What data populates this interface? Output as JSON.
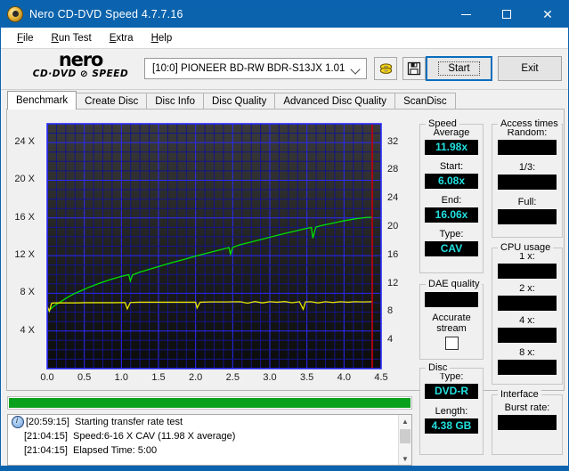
{
  "window": {
    "title": "Nero CD-DVD Speed 4.7.7.16",
    "icon": "nero-disc-icon",
    "minimize": "–",
    "maximize": "□",
    "close": "✕"
  },
  "menu": [
    {
      "pre": "",
      "acc": "F",
      "post": "ile"
    },
    {
      "pre": "",
      "acc": "R",
      "post": "un Test"
    },
    {
      "pre": "",
      "acc": "E",
      "post": "xtra"
    },
    {
      "pre": "",
      "acc": "H",
      "post": "elp"
    }
  ],
  "logo": {
    "line1": "nero",
    "line2": "CD·DVD ⊘ SPEED"
  },
  "toolbar": {
    "drive": "[10:0]   PIONEER BD-RW  BDR-S13JX 1.01",
    "eject_icon": "eject-disc-icon",
    "save_icon": "floppy-save-icon",
    "start_label": "Start",
    "exit_label": "Exit"
  },
  "tabs": [
    {
      "label": "Benchmark",
      "active": true
    },
    {
      "label": "Create Disc",
      "active": false
    },
    {
      "label": "Disc Info",
      "active": false
    },
    {
      "label": "Disc Quality",
      "active": false
    },
    {
      "label": "Advanced Disc Quality",
      "active": false
    },
    {
      "label": "ScanDisc",
      "active": false
    }
  ],
  "panels": {
    "speed": {
      "title": "Speed",
      "average_label": "Average",
      "average_value": "11.98x",
      "start_label": "Start:",
      "start_value": "6.08x",
      "end_label": "End:",
      "end_value": "16.06x",
      "type_label": "Type:",
      "type_value": "CAV"
    },
    "dae": {
      "title": "DAE quality",
      "value": "",
      "accurate_label": "Accurate",
      "stream_label": "stream",
      "checked": false
    },
    "disc": {
      "title": "Disc",
      "type_label": "Type:",
      "type_value": "DVD-R",
      "length_label": "Length:",
      "length_value": "4.38 GB"
    },
    "access": {
      "title": "Access times",
      "random_label": "Random:",
      "random_value": "",
      "third_label": "1/3:",
      "third_value": "",
      "full_label": "Full:",
      "full_value": ""
    },
    "cpu": {
      "title": "CPU usage",
      "rows": [
        {
          "label": "1 x:",
          "value": ""
        },
        {
          "label": "2 x:",
          "value": ""
        },
        {
          "label": "4 x:",
          "value": ""
        },
        {
          "label": "8 x:",
          "value": ""
        }
      ]
    },
    "interface": {
      "title": "Interface",
      "burst_label": "Burst rate:",
      "burst_value": ""
    }
  },
  "progress": {
    "percent": 100
  },
  "log": [
    {
      "icon": "info-icon",
      "time": "[20:59:15]",
      "message": "Starting transfer rate test"
    },
    {
      "icon": "",
      "time": "[21:04:15]",
      "message": "Speed:6-16 X CAV (11.98 X average)"
    },
    {
      "icon": "",
      "time": "[21:04:15]",
      "message": "Elapsed Time:  5:00"
    }
  ],
  "colors": {
    "title_bar": "#0b63ad",
    "graph_bg": "#111111",
    "grid": "#1414c8",
    "speed_curve": "#00e000",
    "transfer_curve": "#e8e800",
    "end_marker": "#cc0000",
    "value_text": "#22e0e0",
    "progress": "#0aa11e"
  },
  "chart_data": {
    "type": "line",
    "title": "",
    "xlabel": "",
    "ylabel": "",
    "xlim": [
      0.0,
      4.5
    ],
    "ylim": [
      0,
      26
    ],
    "y2lim": [
      0,
      34.6
    ],
    "grid": true,
    "x_ticks": [
      "0.0",
      "0.5",
      "1.0",
      "1.5",
      "2.0",
      "2.5",
      "3.0",
      "3.5",
      "4.0",
      "4.5"
    ],
    "x_tick_values": [
      0.0,
      0.5,
      1.0,
      1.5,
      2.0,
      2.5,
      3.0,
      3.5,
      4.0,
      4.5
    ],
    "y_ticks": [
      "4 X",
      "8 X",
      "12 X",
      "16 X",
      "20 X",
      "24 X"
    ],
    "y_tick_values": [
      4,
      8,
      12,
      16,
      20,
      24
    ],
    "y2_ticks": [
      "4",
      "8",
      "12",
      "16",
      "20",
      "24",
      "28",
      "32"
    ],
    "y2_tick_values": [
      4,
      8,
      12,
      16,
      20,
      24,
      28,
      32
    ],
    "end_marker_x": 4.38,
    "series": [
      {
        "name": "Read speed (X)",
        "color": "#00e000",
        "axis": "left",
        "x": [
          0.0,
          0.05,
          0.1,
          0.18,
          0.25,
          0.35,
          0.45,
          0.55,
          0.7,
          0.85,
          1.0,
          1.1,
          1.12,
          1.15,
          1.25,
          1.4,
          1.55,
          1.7,
          1.85,
          2.0,
          2.15,
          2.3,
          2.45,
          2.47,
          2.5,
          2.6,
          2.75,
          2.9,
          3.05,
          3.2,
          3.35,
          3.5,
          3.56,
          3.58,
          3.62,
          3.7,
          3.85,
          4.0,
          4.15,
          4.3,
          4.38
        ],
        "y": [
          6.08,
          6.35,
          6.7,
          7.1,
          7.45,
          7.9,
          8.25,
          8.6,
          9.05,
          9.45,
          9.8,
          9.98,
          9.3,
          9.95,
          10.25,
          10.6,
          10.95,
          11.3,
          11.6,
          11.95,
          12.25,
          12.55,
          12.85,
          12.15,
          12.88,
          13.15,
          13.45,
          13.75,
          14.05,
          14.35,
          14.62,
          14.9,
          14.98,
          13.85,
          15.02,
          15.2,
          15.45,
          15.7,
          15.9,
          16.05,
          16.06
        ]
      },
      {
        "name": "Transfer rate (X)",
        "color": "#e8e800",
        "axis": "left",
        "x": [
          0.0,
          0.03,
          0.06,
          0.1,
          0.2,
          0.3,
          0.4,
          0.5,
          0.6,
          0.7,
          0.8,
          0.9,
          1.05,
          1.08,
          1.12,
          1.25,
          1.45,
          1.65,
          1.85,
          2.0,
          2.02,
          2.06,
          2.2,
          2.4,
          2.6,
          2.7,
          2.8,
          2.9,
          3.0,
          3.1,
          3.2,
          3.3,
          3.4,
          3.45,
          3.48,
          3.55,
          3.65,
          3.75,
          3.85,
          3.95,
          4.05,
          4.15,
          4.25,
          4.38
        ],
        "y": [
          6.6,
          6.1,
          6.95,
          6.98,
          6.98,
          6.98,
          6.98,
          7.0,
          7.0,
          7.0,
          7.0,
          7.0,
          7.02,
          6.35,
          7.02,
          7.05,
          7.05,
          7.05,
          7.05,
          7.05,
          6.45,
          7.05,
          7.08,
          7.08,
          7.1,
          6.95,
          7.12,
          6.98,
          7.1,
          7.05,
          7.12,
          7.0,
          7.1,
          6.3,
          7.08,
          7.1,
          6.98,
          7.1,
          7.02,
          7.1,
          7.05,
          7.1,
          7.08,
          7.1
        ]
      }
    ]
  }
}
